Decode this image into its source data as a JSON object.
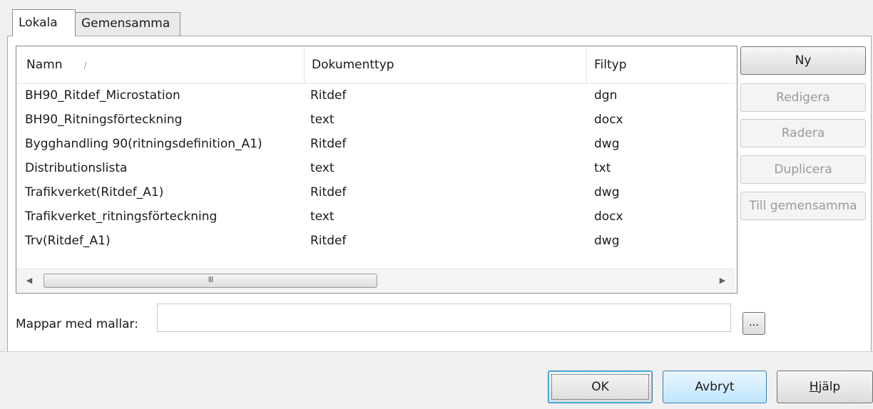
{
  "tabs": [
    {
      "label": "Lokala"
    },
    {
      "label": "Gemensamma"
    }
  ],
  "list": {
    "columns": [
      "Namn",
      "Dokumenttyp",
      "Filtyp"
    ],
    "sort_glyph": "/",
    "rows": [
      [
        "BH90_Ritdef_Microstation",
        "Ritdef",
        "dgn"
      ],
      [
        "BH90_Ritningsförteckning",
        "text",
        "docx"
      ],
      [
        "Bygghandling 90(ritningsdefinition_A1)",
        "Ritdef",
        "dwg"
      ],
      [
        "Distributionslista",
        "text",
        "txt"
      ],
      [
        "Trafikverket(Ritdef_A1)",
        "Ritdef",
        "dwg"
      ],
      [
        "Trafikverket_ritningsförteckning",
        "text",
        "docx"
      ],
      [
        "Trv(Ritdef_A1)",
        "Ritdef",
        "dwg"
      ]
    ],
    "scroll_grip": "III"
  },
  "side_buttons": [
    {
      "label": "Ny",
      "enabled": true
    },
    {
      "label": "Redigera",
      "enabled": false
    },
    {
      "label": "Radera",
      "enabled": false
    },
    {
      "label": "Duplicera",
      "enabled": false
    },
    {
      "label": "Till gemensamma",
      "enabled": false
    }
  ],
  "folder": {
    "label": "Mappar med mallar:",
    "value": "",
    "browse_label": "..."
  },
  "buttons": {
    "ok": "OK",
    "cancel": "Avbryt",
    "help_accel": "H",
    "help_rest": "jälp"
  }
}
